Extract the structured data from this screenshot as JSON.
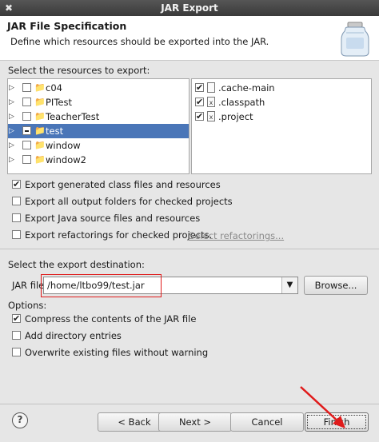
{
  "window": {
    "title": "JAR Export",
    "close_glyph": "✖"
  },
  "header": {
    "title": "JAR File Specification",
    "description": "Define which resources should be exported into the JAR."
  },
  "resources": {
    "label": "Select the resources to export:",
    "projects": [
      {
        "name": "c04",
        "checked": false,
        "expanded": false,
        "selected": false
      },
      {
        "name": "PITest",
        "checked": false,
        "expanded": false,
        "selected": false
      },
      {
        "name": "TeacherTest",
        "checked": false,
        "expanded": false,
        "selected": false
      },
      {
        "name": "test",
        "checked": "partial",
        "expanded": false,
        "selected": true
      },
      {
        "name": "window",
        "checked": false,
        "expanded": false,
        "selected": false
      },
      {
        "name": "window2",
        "checked": false,
        "expanded": false,
        "selected": false
      }
    ],
    "files": [
      {
        "name": ".cache-main",
        "checked": true
      },
      {
        "name": ".classpath",
        "checked": true
      },
      {
        "name": ".project",
        "checked": true
      }
    ]
  },
  "export_options": {
    "generated_class_files": {
      "label": "Export generated class files and resources",
      "checked": true
    },
    "output_folders": {
      "label": "Export all output folders for checked projects",
      "checked": false
    },
    "java_source": {
      "label": "Export Java source files and resources",
      "checked": false
    },
    "refactorings": {
      "label": "Export refactorings for checked projects.",
      "checked": false
    },
    "select_refactorings_link": "Select refactorings..."
  },
  "destination": {
    "label": "Select the export destination:",
    "jar_file_label": "JAR file:",
    "jar_file_value": "/home/ltbo99/test.jar",
    "browse_label": "Browse..."
  },
  "options": {
    "label": "Options:",
    "compress": {
      "label": "Compress the contents of the JAR file",
      "checked": true
    },
    "directory_entries": {
      "label": "Add directory entries",
      "checked": false
    },
    "overwrite": {
      "label": "Overwrite existing files without warning",
      "checked": false
    }
  },
  "buttons": {
    "help": "?",
    "back": "< Back",
    "next": "Next >",
    "cancel": "Cancel",
    "finish": "Finish"
  },
  "colors": {
    "selection": "#4a76b8",
    "annotation_red": "#e01b1b"
  },
  "icons": {
    "project": "java-project-icon",
    "file": "text-file-icon",
    "expand": "expand-triangle-icon",
    "jar": "jar-icon"
  }
}
